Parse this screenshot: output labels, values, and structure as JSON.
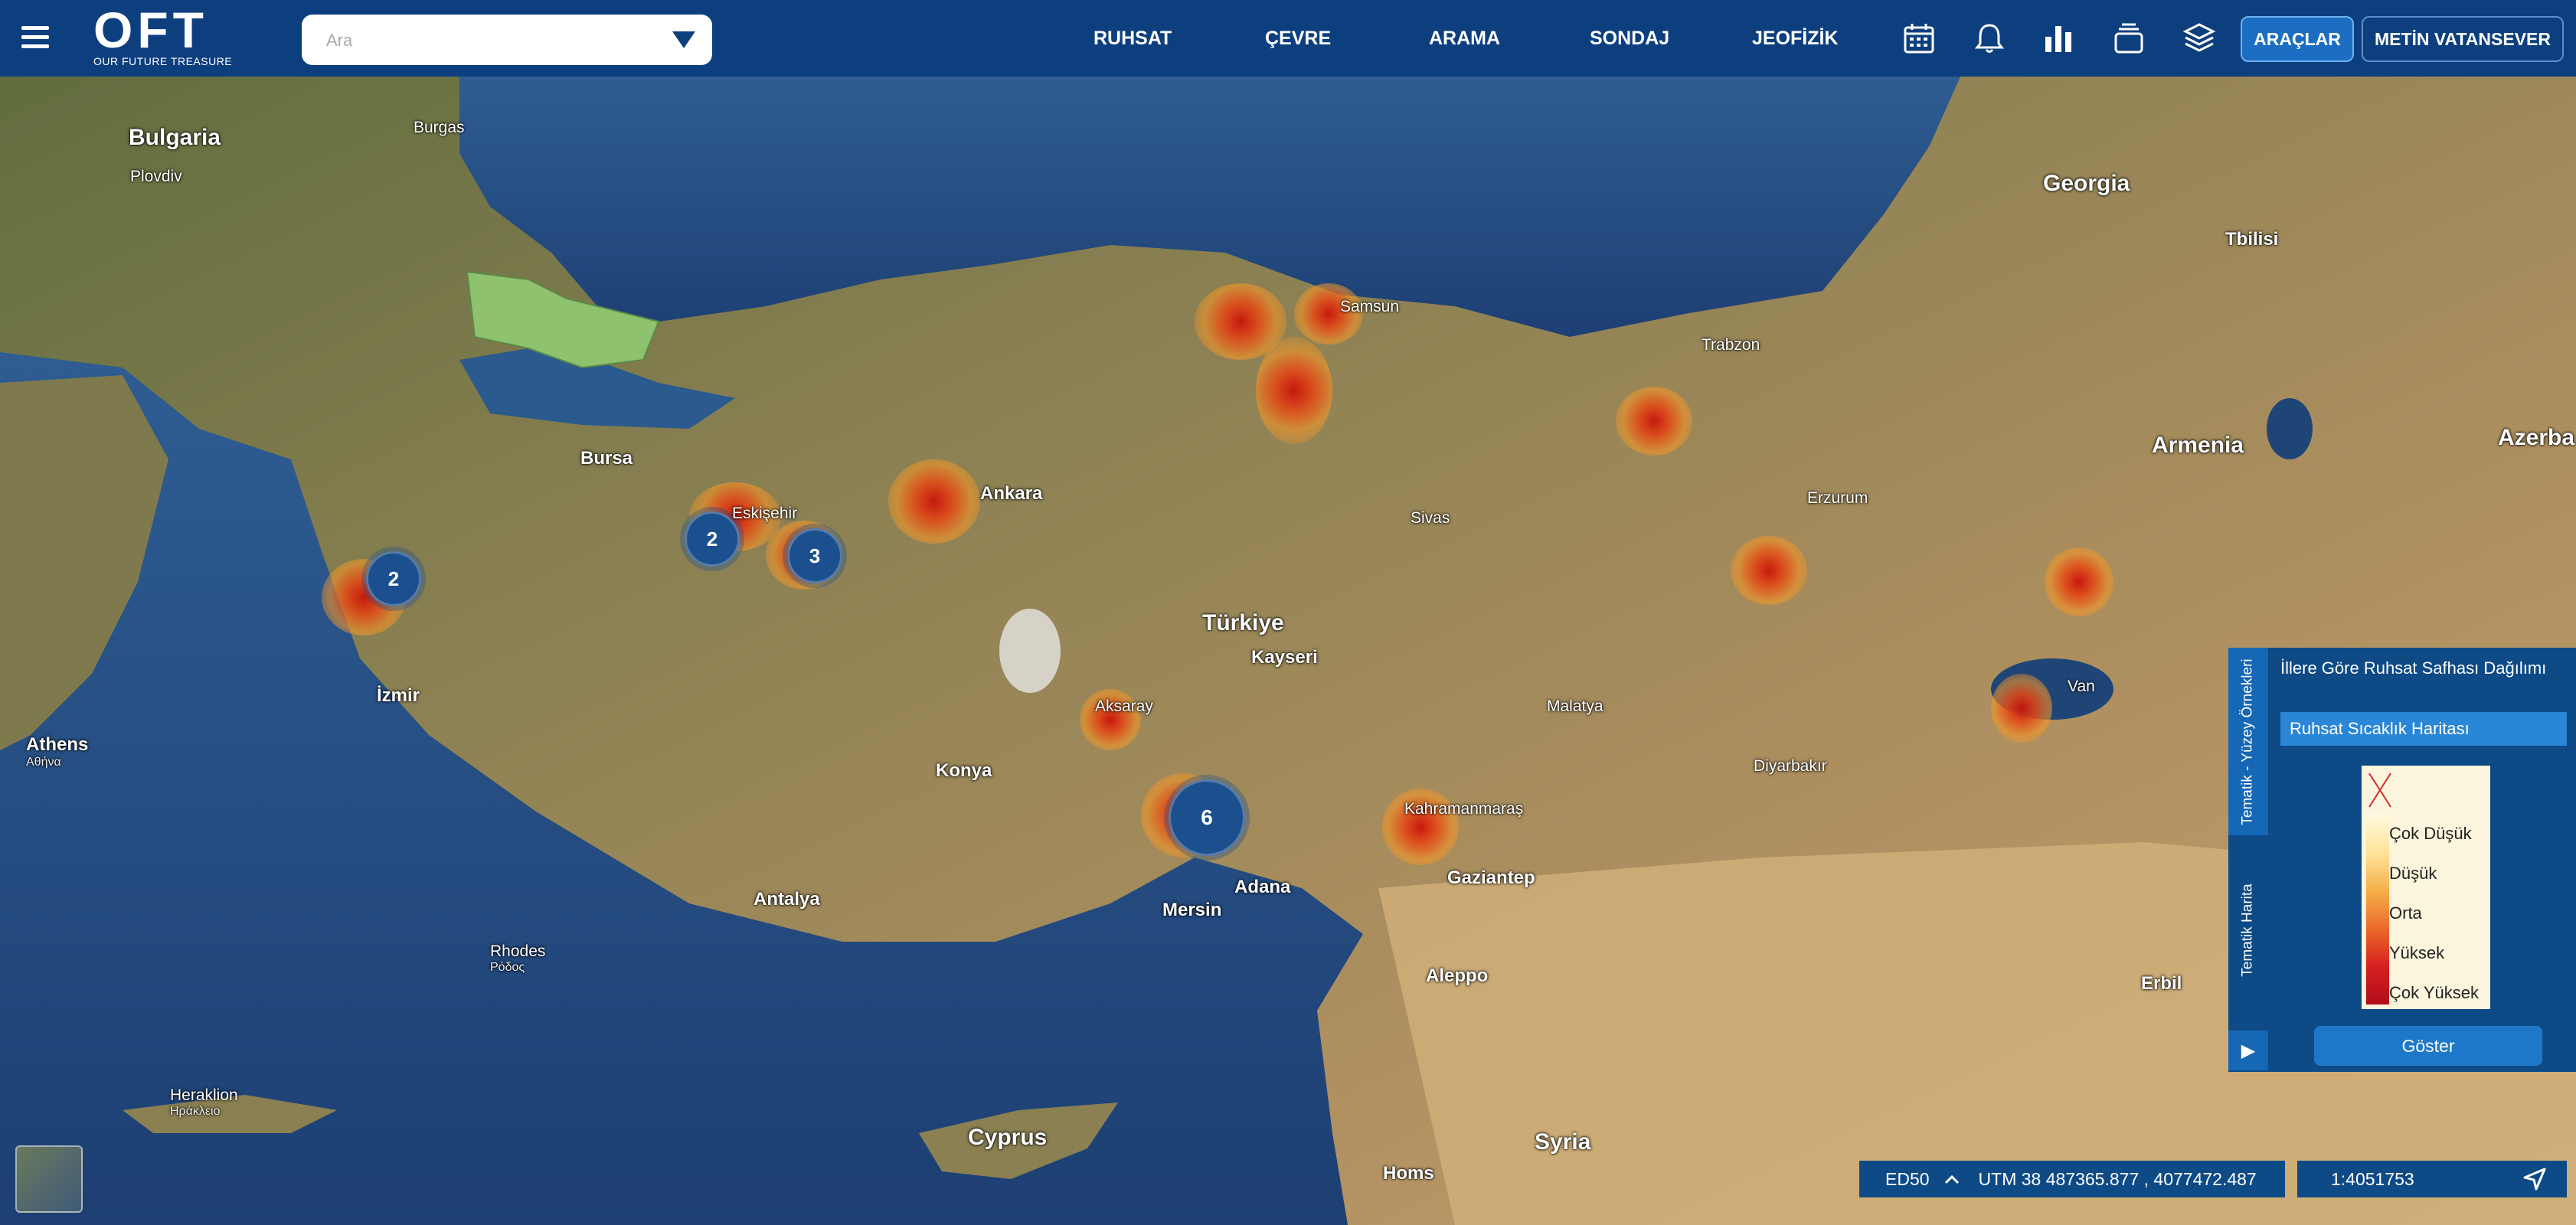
{
  "header": {
    "logo": "OFT",
    "logo_sub": "OUR FUTURE TREASURE",
    "search_placeholder": "Ara",
    "nav": [
      "RUHSAT",
      "ÇEVRE",
      "ARAMA",
      "SONDAJ",
      "JEOFİZİK"
    ],
    "icons": [
      "calendar-icon",
      "bell-icon",
      "bar-chart-icon",
      "stack-icon",
      "layers-icon"
    ],
    "tools_button": "ARAÇLAR",
    "user_button": "METİN VATANSEVER"
  },
  "map": {
    "labels": {
      "countries": [
        "Bulgaria",
        "Georgia",
        "Armenia",
        "Azerba",
        "Türkiye",
        "Cyprus",
        "Syria"
      ],
      "cities": [
        "Ankara",
        "Konya",
        "Antalya",
        "Adana",
        "Mersin",
        "Kayseri",
        "Bursa",
        "İzmir",
        "Samsun",
        "Eskişehir",
        "Aleppo",
        "Gaziantep",
        "Erzurum",
        "Sivas",
        "Malatya",
        "Van",
        "Homs",
        "Tbilisi",
        "Trabzon",
        "Athens",
        "Rhodes",
        "Heraklion",
        "Plovdiv",
        "Burgas",
        "Diyarbakır",
        "Kahramanmaraş",
        "Aksaray",
        "Erbil"
      ],
      "greek": [
        "Αθήνα",
        "Ρόδος",
        "Ηράκλειο"
      ]
    },
    "clusters": [
      "2",
      "2",
      "3",
      "6"
    ]
  },
  "panel": {
    "tab_vertical_1": "Tematik - Yüzey Örnekleri",
    "tab_vertical_2": "Tematik Harita",
    "item_1": "İllere Göre Ruhsat Safhası Dağılımı",
    "item_2": "Ruhsat Sıcaklık Haritası",
    "legend": [
      "Çok Düşük",
      "Düşük",
      "Orta",
      "Yüksek",
      "Çok Yüksek"
    ],
    "button": "Göster",
    "play": "▶"
  },
  "status": {
    "datum": "ED50",
    "coords": "UTM 38 487365.877 , 4077472.487",
    "scale": "1:4051753"
  },
  "colors": {
    "header_bg": "#0d3f7f",
    "accent": "#1b6ec2",
    "panel_bg": "#0e4a86",
    "selected_item": "#2a86d6"
  }
}
